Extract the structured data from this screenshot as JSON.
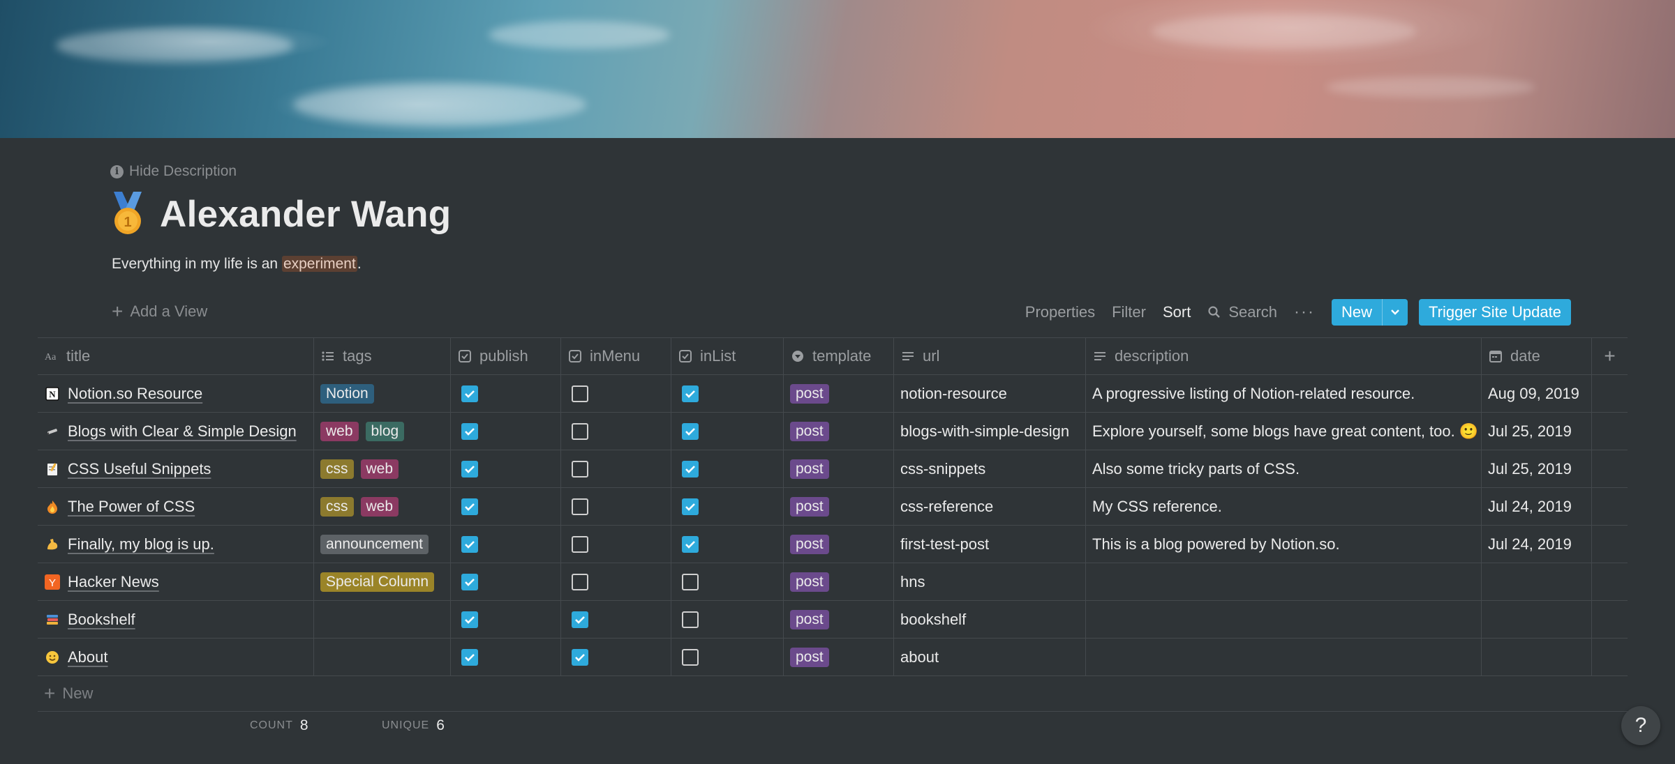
{
  "header": {
    "hide_description": "Hide Description",
    "title": "Alexander Wang",
    "description_prefix": "Everything in my life is an ",
    "description_highlight": "experiment",
    "description_suffix": "."
  },
  "toolbar": {
    "add_view": "Add a View",
    "properties": "Properties",
    "filter": "Filter",
    "sort": "Sort",
    "search": "Search",
    "more": "···",
    "new": "New",
    "trigger": "Trigger Site Update"
  },
  "columns": {
    "title": "title",
    "tags": "tags",
    "publish": "publish",
    "inMenu": "inMenu",
    "inList": "inList",
    "template": "template",
    "url": "url",
    "description": "description",
    "date": "date",
    "add": "+"
  },
  "colors": {
    "accent": "#2eaadc",
    "tag_notion": "#2e5f7d",
    "tag_web": "#8b3a62",
    "tag_blog": "#3b6b62",
    "tag_css": "#8c7a2e",
    "tag_announcement": "#5d6266",
    "tag_special": "#9a8428",
    "tag_post": "#6b4a8c"
  },
  "rows": [
    {
      "icon": "notion-icon",
      "title": "Notion.so Resource",
      "tags": [
        {
          "label": "Notion",
          "color": "#2e5f7d"
        }
      ],
      "publish": true,
      "inMenu": false,
      "inList": true,
      "template": "post",
      "url": "notion-resource",
      "description": "A progressive listing of Notion-related resource.",
      "date": "Aug 09, 2019"
    },
    {
      "icon": "pencil-icon",
      "title": "Blogs with Clear & Simple Design",
      "tags": [
        {
          "label": "web",
          "color": "#8b3a62"
        },
        {
          "label": "blog",
          "color": "#3b6b62"
        }
      ],
      "publish": true,
      "inMenu": false,
      "inList": true,
      "template": "post",
      "url": "blogs-with-simple-design",
      "description": "Explore yourself, some blogs have great content, too. 🙂",
      "date": "Jul 25, 2019"
    },
    {
      "icon": "memo-icon",
      "title": "CSS Useful Snippets",
      "tags": [
        {
          "label": "css",
          "color": "#8c7a2e"
        },
        {
          "label": "web",
          "color": "#8b3a62"
        }
      ],
      "publish": true,
      "inMenu": false,
      "inList": true,
      "template": "post",
      "url": "css-snippets",
      "description": "Also some tricky parts of CSS.",
      "date": "Jul 25, 2019"
    },
    {
      "icon": "fire-icon",
      "title": "The Power of CSS",
      "tags": [
        {
          "label": "css",
          "color": "#8c7a2e"
        },
        {
          "label": "web",
          "color": "#8b3a62"
        }
      ],
      "publish": true,
      "inMenu": false,
      "inList": true,
      "template": "post",
      "url": "css-reference",
      "description": "My CSS reference.",
      "date": "Jul 24, 2019"
    },
    {
      "icon": "flexed-biceps-icon",
      "title": "Finally, my blog is up.",
      "tags": [
        {
          "label": "announcement",
          "color": "#5d6266"
        }
      ],
      "publish": true,
      "inMenu": false,
      "inList": true,
      "template": "post",
      "url": "first-test-post",
      "description": "This is a blog powered by Notion.so.",
      "date": "Jul 24, 2019"
    },
    {
      "icon": "hacker-news-icon",
      "title": "Hacker News",
      "tags": [
        {
          "label": "Special Column",
          "color": "#9a8428"
        }
      ],
      "publish": true,
      "inMenu": false,
      "inList": false,
      "template": "post",
      "url": "hns",
      "description": "",
      "date": ""
    },
    {
      "icon": "books-icon",
      "title": "Bookshelf",
      "tags": [],
      "publish": true,
      "inMenu": true,
      "inList": false,
      "template": "post",
      "url": "bookshelf",
      "description": "",
      "date": ""
    },
    {
      "icon": "smile-icon",
      "title": "About",
      "tags": [],
      "publish": true,
      "inMenu": true,
      "inList": false,
      "template": "post",
      "url": "about",
      "description": "",
      "date": ""
    }
  ],
  "footer": {
    "new_row": "New",
    "count_label": "COUNT",
    "count_value": "8",
    "unique_label": "UNIQUE",
    "unique_value": "6",
    "help": "?"
  }
}
